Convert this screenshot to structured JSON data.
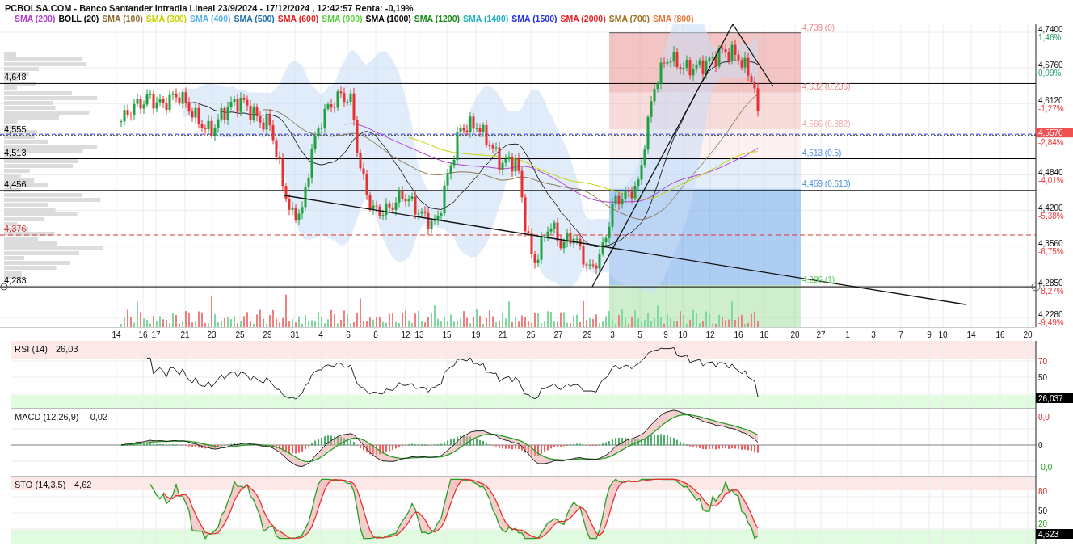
{
  "header": {
    "title": "PCBOLSA.COM - Banco Santander Intradia Lineal 23/9/2024 - 17/12/2024 , 12:42:57 Renta: -0,19%"
  },
  "legend": [
    {
      "label": "SMA (200)",
      "color": "#b040d0"
    },
    {
      "label": "BOLL (20)",
      "color": "#000000"
    },
    {
      "label": "SMA (100)",
      "color": "#8b6a2a"
    },
    {
      "label": "SMA (300)",
      "color": "#c8d400"
    },
    {
      "label": "SMA (400)",
      "color": "#5ab0e8"
    },
    {
      "label": "SMA (500)",
      "color": "#1f6fb0"
    },
    {
      "label": "SMA (600)",
      "color": "#e82020"
    },
    {
      "label": "SMA (900)",
      "color": "#5cd040"
    },
    {
      "label": "SMA (1000)",
      "color": "#000000"
    },
    {
      "label": "SMA (1200)",
      "color": "#1a8a1a"
    },
    {
      "label": "SMA (1400)",
      "color": "#20b0c0"
    },
    {
      "label": "SMA (1500)",
      "color": "#2030e0"
    },
    {
      "label": "SMA (2000)",
      "color": "#e82020"
    },
    {
      "label": "SMA (700)",
      "color": "#a07020"
    },
    {
      "label": "SMA (800)",
      "color": "#e87840"
    }
  ],
  "levels": [
    {
      "label": "4,648",
      "kind": "solid",
      "color": "#000000"
    },
    {
      "label": "4,555",
      "kind": "dotted",
      "color": "#000000"
    },
    {
      "label": "4,513",
      "kind": "solid",
      "color": "#000000"
    },
    {
      "label": "4,456",
      "kind": "solid",
      "color": "#000000"
    },
    {
      "label": "4,376",
      "kind": "dashed",
      "color": "#e03030"
    },
    {
      "label": "4,283",
      "kind": "solid",
      "color": "#000000"
    }
  ],
  "fibonacci": [
    {
      "label": "4,739 (0)",
      "color": "#e88a8a"
    },
    {
      "label": "4,632 (0.236)",
      "color": "#e88a8a"
    },
    {
      "label": "4,566 (0.382)",
      "color": "#f2a8a8"
    },
    {
      "label": "4,513 (0.5)",
      "color": "#4a90e2"
    },
    {
      "label": "4,459 (0.618)",
      "color": "#4a90e2"
    },
    {
      "label": "4,286 (1)",
      "color": "#5cc85c"
    }
  ],
  "price_axis": [
    {
      "price": "4,7400",
      "change": "1,46%",
      "positive": true
    },
    {
      "price": "4,6760",
      "change": "0,09%",
      "positive": true
    },
    {
      "price": "4,6120",
      "change": "-1,27%",
      "positive": false
    },
    {
      "price": "4,4840",
      "change": "-4,01%",
      "positive": false
    },
    {
      "price": "4,4200",
      "change": "-5,38%",
      "positive": false
    },
    {
      "price": "4,3560",
      "change": "-6,75%",
      "positive": false
    },
    {
      "price": "4,2850",
      "change": "-8,27%",
      "positive": false
    },
    {
      "price": "4,2280",
      "change": "-9,49%",
      "positive": false
    }
  ],
  "current_price": {
    "price": "4,5570",
    "change": "-2,84%"
  },
  "x_axis": [
    "14",
    "16",
    "17",
    "21",
    "23",
    "25",
    "29",
    "31",
    "4",
    "6",
    "8",
    "12",
    "13",
    "15",
    "19",
    "21",
    "25",
    "27",
    "29",
    "3",
    "5",
    "9",
    "10",
    "12",
    "16",
    "18",
    "20",
    "27",
    "1",
    "3",
    "7",
    "9",
    "10",
    "14",
    "16",
    "20"
  ],
  "indicators": [
    {
      "kind": "rsi",
      "title": "RSI (14)",
      "value": "26,03",
      "ticks": [
        {
          "label": "70",
          "kind": "upper"
        },
        {
          "label": "50",
          "kind": "middle"
        }
      ],
      "reading": "26,037"
    },
    {
      "kind": "macd",
      "title": "MACD (12,26,9)",
      "value": "-0,02",
      "ticks": [
        {
          "label": "0,0",
          "kind": "upper"
        },
        {
          "label": "0",
          "kind": "middle"
        },
        {
          "label": "-0,0",
          "kind": "lower"
        }
      ]
    },
    {
      "kind": "sto",
      "title": "STO (14,3,5)",
      "value": "4,62",
      "ticks": [
        {
          "label": "80",
          "kind": "upper"
        },
        {
          "label": "50",
          "kind": "middle"
        },
        {
          "label": "20",
          "kind": "lower"
        }
      ],
      "reading": "4,623"
    }
  ]
}
